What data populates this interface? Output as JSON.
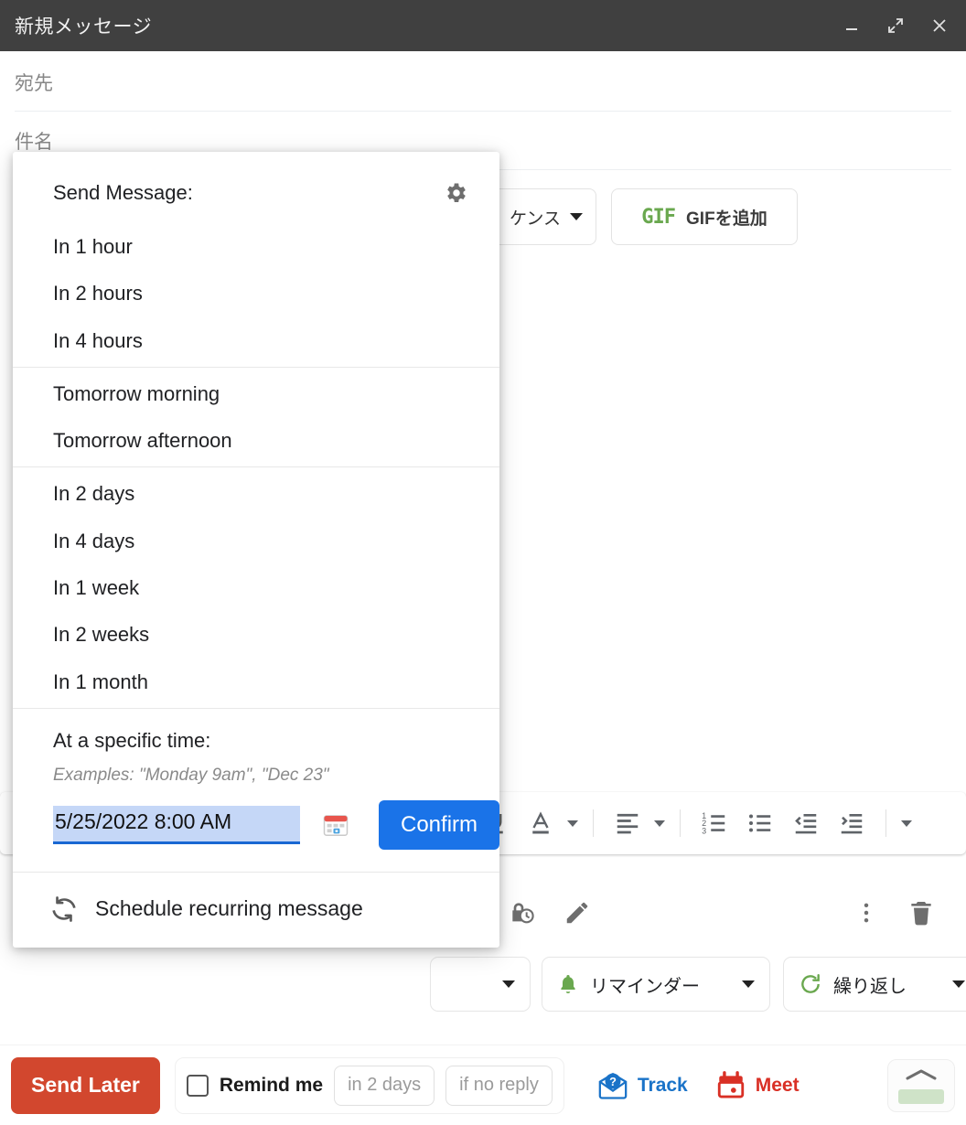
{
  "window": {
    "title": "新規メッセージ",
    "controls": [
      {
        "name": "minimize-button",
        "icon": "minimize-icon"
      },
      {
        "name": "expand-button",
        "icon": "expand-icon"
      },
      {
        "name": "close-button",
        "icon": "close-icon"
      }
    ]
  },
  "compose": {
    "to_label": "宛先",
    "subject_label": "件名",
    "sequence_button": "ケンス",
    "gif_button": {
      "mark": "GIF",
      "label": "GIFを追加"
    }
  },
  "format_toolbar": {
    "items": [
      {
        "name": "underline-button",
        "icon": "underline-icon"
      },
      {
        "name": "text-color-button",
        "icon": "text-color-icon"
      },
      {
        "name": "align-button",
        "icon": "align-left-icon"
      },
      {
        "name": "numbered-list-button",
        "icon": "numbered-list-icon"
      },
      {
        "name": "bulleted-list-button",
        "icon": "bulleted-list-icon"
      },
      {
        "name": "indent-less-button",
        "icon": "indent-decrease-icon"
      },
      {
        "name": "indent-more-button",
        "icon": "indent-increase-icon"
      },
      {
        "name": "more-format-button",
        "icon": "chevron-down-icon"
      }
    ]
  },
  "action_strip": {
    "items": [
      {
        "name": "confidential-mode-button",
        "icon": "lock-clock-icon"
      },
      {
        "name": "signature-button",
        "icon": "pen-icon"
      },
      {
        "name": "more-options-button",
        "icon": "kebab-menu-icon"
      },
      {
        "name": "discard-draft-button",
        "icon": "trash-icon"
      }
    ]
  },
  "bottom_dropdowns": {
    "reminder": {
      "label": "リマインダー",
      "icon": "bell-icon"
    },
    "repeat": {
      "label": "繰り返し",
      "icon": "repeat-icon"
    }
  },
  "bottom_bar": {
    "send_later_label": "Send Later",
    "remind_me_label": "Remind me",
    "remind_when_placeholder": "in 2 days",
    "remind_condition_placeholder": "if no reply",
    "track_label": "Track",
    "meet_label": "Meet"
  },
  "scheduler_panel": {
    "header": "Send Message:",
    "settings_icon": "gear-icon",
    "quick_options": [
      "In 1 hour",
      "In 2 hours",
      "In 4 hours"
    ],
    "tomorrow_options": [
      "Tomorrow morning",
      "Tomorrow afternoon"
    ],
    "later_options": [
      "In 2 days",
      "In 4 days",
      "In 1 week",
      "In 2 weeks",
      "In 1 month"
    ],
    "specific": {
      "title": "At a specific time:",
      "examples": "Examples: \"Monday 9am\", \"Dec 23\"",
      "datetime_value": "5/25/2022 8:00 AM",
      "datepicker_icon": "calendar-icon",
      "confirm_label": "Confirm"
    },
    "recurring": {
      "label": "Schedule recurring message",
      "icon": "refresh-icon"
    }
  },
  "colors": {
    "titlebar_bg": "#404040",
    "send_later": "#d2472e",
    "confirm": "#1a73e8",
    "selection": "#c5d7f7",
    "track": "#1a73c8",
    "meet": "#d93025",
    "gif": "#6aa84f"
  }
}
